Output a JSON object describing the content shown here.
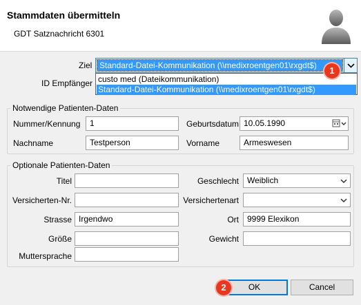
{
  "header": {
    "title": "Stammdaten übermitteln",
    "subtitle": "GDT Satznachricht 6301"
  },
  "ziel": {
    "label": "Ziel",
    "selected": "Standard-Datei-Kommunikation (\\\\medixroentgen01\\rxgdt$)",
    "options": [
      "custo med (Dateikommunikation)",
      "Standard-Datei-Kommunikation (\\\\medixroentgen01\\rxgdt$)"
    ],
    "selected_index": 1
  },
  "id_empfaenger": {
    "label": "ID Empfänger"
  },
  "notwendige": {
    "title": "Notwendige Patienten-Daten",
    "nummer_label": "Nummer/Kennung",
    "nummer_value": "1",
    "geburtsdatum_label": "Geburtsdatum",
    "geburtsdatum_value": "10.05.1990",
    "nachname_label": "Nachname",
    "nachname_value": "Testperson",
    "vorname_label": "Vorname",
    "vorname_value": "Armeswesen"
  },
  "optionale": {
    "title": "Optionale Patienten-Daten",
    "titel_label": "Titel",
    "titel_value": "",
    "geschlecht_label": "Geschlecht",
    "geschlecht_value": "Weiblich",
    "versichertennr_label": "Versicherten-Nr.",
    "versichertennr_value": "",
    "versichertenart_label": "Versichertenart",
    "versichertenart_value": "",
    "strasse_label": "Strasse",
    "strasse_value": "Irgendwo",
    "ort_label": "Ort",
    "ort_value": "9999 Elexikon",
    "groesse_label": "Größe",
    "groesse_value": "",
    "gewicht_label": "Gewicht",
    "gewicht_value": "",
    "muttersprache_label": "Muttersprache",
    "muttersprache_value": ""
  },
  "badges": {
    "one": "1",
    "two": "2"
  },
  "buttons": {
    "ok": "OK",
    "cancel": "Cancel"
  },
  "colors": {
    "selection": "#3399ff",
    "badge": "#e8371e",
    "focus_border": "#0078d7"
  },
  "icons": {
    "avatar": "user-avatar-icon",
    "dropdown": "chevron-down-icon",
    "calendar": "calendar-icon"
  }
}
